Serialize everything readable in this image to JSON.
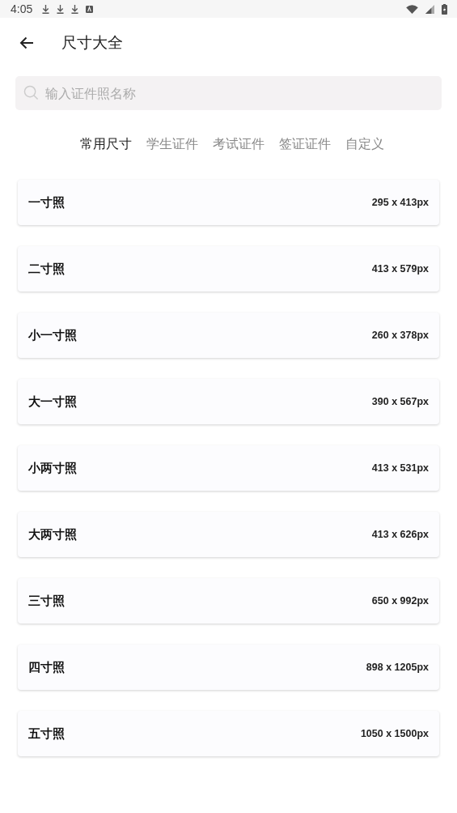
{
  "status_bar": {
    "time": "4:05"
  },
  "header": {
    "title": "尺寸大全"
  },
  "search": {
    "placeholder": "输入证件照名称"
  },
  "tabs": [
    {
      "label": "常用尺寸",
      "selected": true
    },
    {
      "label": "学生证件",
      "selected": false
    },
    {
      "label": "考试证件",
      "selected": false
    },
    {
      "label": "签证证件",
      "selected": false
    },
    {
      "label": "自定义",
      "selected": false
    }
  ],
  "sizes": [
    {
      "name": "一寸照",
      "pixels": "295 x 413px"
    },
    {
      "name": "二寸照",
      "pixels": "413 x 579px"
    },
    {
      "name": "小一寸照",
      "pixels": "260 x 378px"
    },
    {
      "name": "大一寸照",
      "pixels": "390 x 567px"
    },
    {
      "name": "小两寸照",
      "pixels": "413 x 531px"
    },
    {
      "name": "大两寸照",
      "pixels": "413 x 626px"
    },
    {
      "name": "三寸照",
      "pixels": "650 x 992px"
    },
    {
      "name": "四寸照",
      "pixels": "898 x 1205px"
    },
    {
      "name": "五寸照",
      "pixels": "1050 x 1500px"
    }
  ]
}
